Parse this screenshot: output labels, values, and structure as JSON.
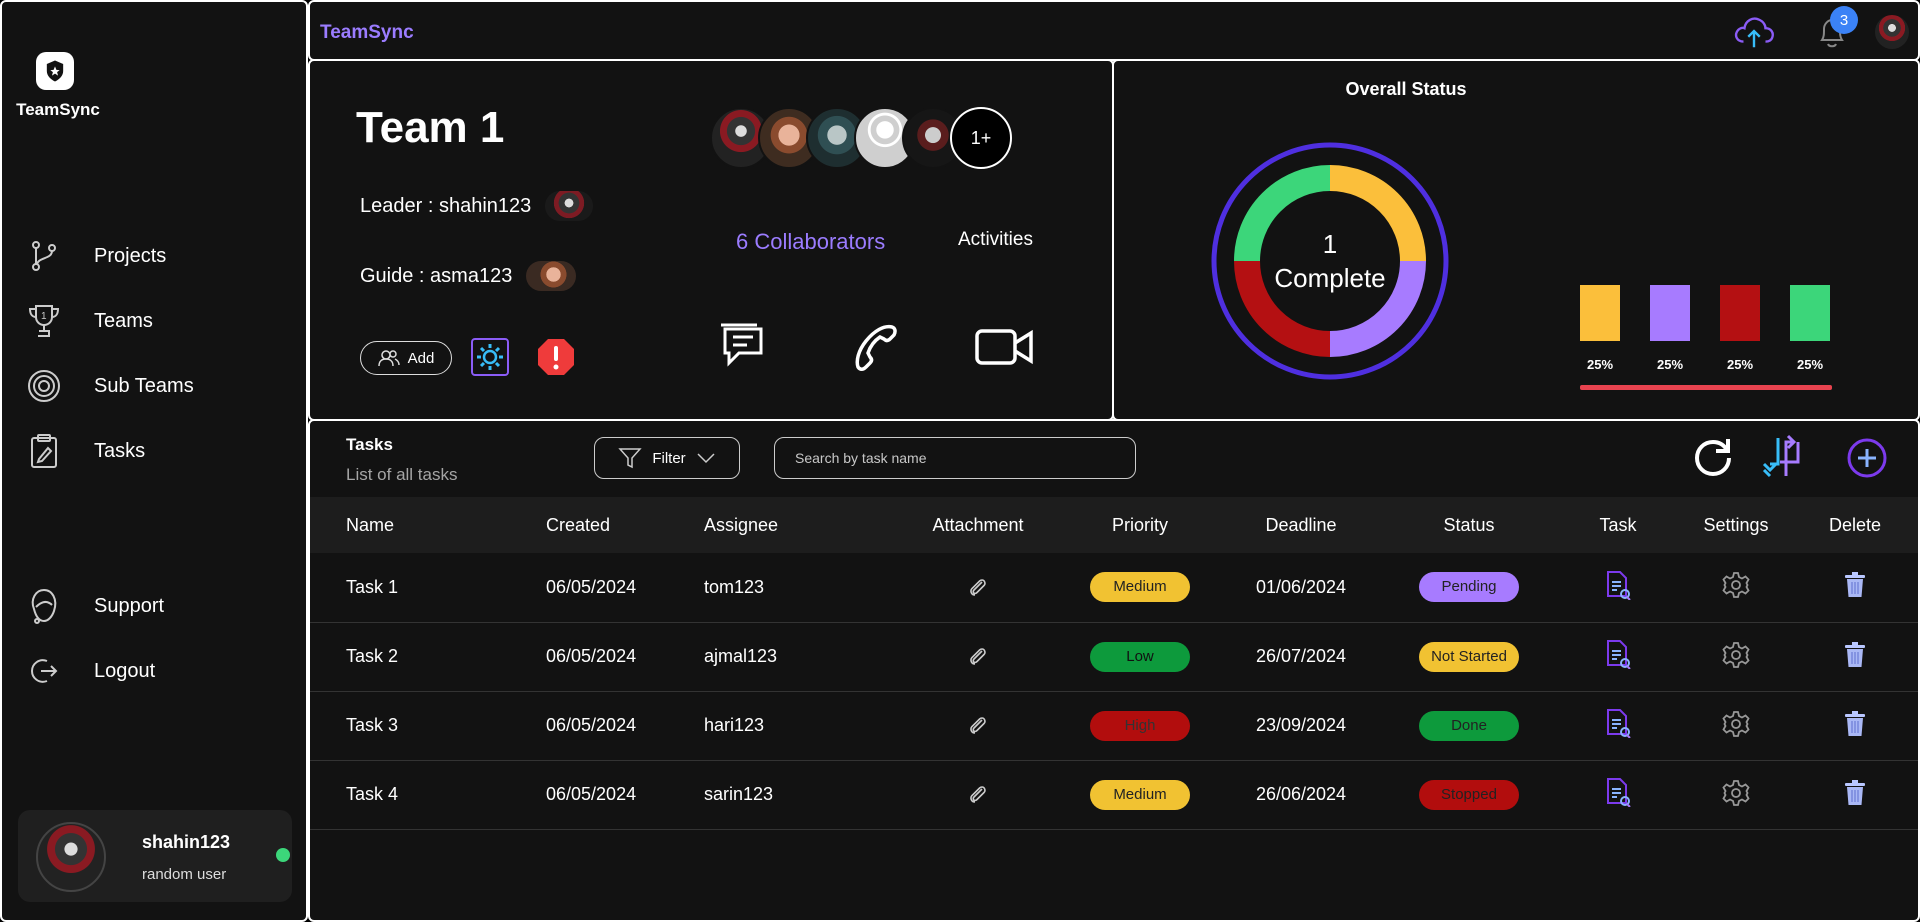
{
  "app": {
    "brand": "TeamSync",
    "header_title": "TeamSync"
  },
  "sidebar": {
    "items": [
      {
        "label": "Projects",
        "icon": "branch-icon"
      },
      {
        "label": "Teams",
        "icon": "trophy-icon"
      },
      {
        "label": "Sub Teams",
        "icon": "target-icon"
      },
      {
        "label": "Tasks",
        "icon": "clipboard-icon"
      }
    ],
    "bottom_items": [
      {
        "label": "Support",
        "icon": "support-icon"
      },
      {
        "label": "Logout",
        "icon": "logout-icon"
      }
    ],
    "user": {
      "name": "shahin123",
      "role": "random user",
      "online_color": "#3cd67a"
    }
  },
  "topbar": {
    "notification_count": "3"
  },
  "team": {
    "title": "Team 1",
    "leader": "Leader : shahin123",
    "guide": "Guide : asma123",
    "add_label": "Add",
    "more_collaborators": "1+",
    "collaborators": "6 Collaborators",
    "activities": "Activities"
  },
  "status": {
    "title": "Overall Status",
    "center_count": "1",
    "center_label": "Complete",
    "bars": [
      {
        "label": "25%",
        "value": 25,
        "color": "#fbbf3b"
      },
      {
        "label": "25%",
        "value": 25,
        "color": "#a77bff"
      },
      {
        "label": "25%",
        "value": 25,
        "color": "#b41012"
      },
      {
        "label": "25%",
        "value": 25,
        "color": "#3cd67a"
      }
    ]
  },
  "tasks": {
    "heading": "Tasks",
    "subheading": "List of all tasks",
    "filter_label": "Filter",
    "search_placeholder": "Search by task name",
    "columns": [
      "Name",
      "Created",
      "Assignee",
      "Attachment",
      "Priority",
      "Deadline",
      "Status",
      "Task",
      "Settings",
      "Delete"
    ],
    "rows": [
      {
        "name": "Task 1",
        "created": "06/05/2024",
        "assignee": "tom123",
        "priority": "Medium",
        "deadline": "01/06/2024",
        "status": "Pending"
      },
      {
        "name": "Task 2",
        "created": "06/05/2024",
        "assignee": "ajmal123",
        "priority": "Low",
        "deadline": "26/07/2024",
        "status": "Not Started"
      },
      {
        "name": "Task 3",
        "created": "06/05/2024",
        "assignee": "hari123",
        "priority": "High",
        "deadline": "23/09/2024",
        "status": "Done"
      },
      {
        "name": "Task 4",
        "created": "06/05/2024",
        "assignee": "sarin123",
        "priority": "Medium",
        "deadline": "26/06/2024",
        "status": "Stopped"
      }
    ],
    "priority_colors": {
      "Medium": "#f1c232",
      "Low": "#0d9a3c",
      "High": "#b20d0d"
    },
    "status_colors": {
      "Pending": "#a77bff",
      "Not Started": "#f1c232",
      "Done": "#0d9a3c",
      "Stopped": "#b20d0d"
    }
  }
}
